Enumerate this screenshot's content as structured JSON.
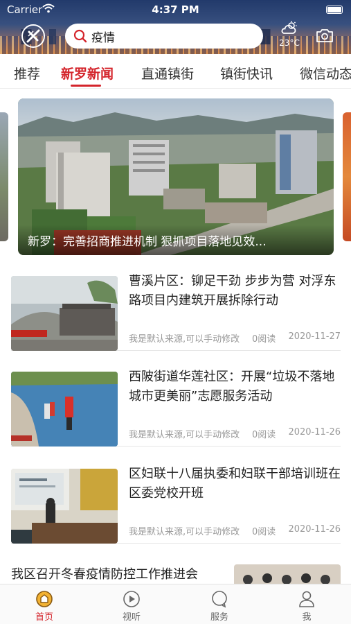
{
  "status_bar": {
    "carrier": "Carrier",
    "time": "4:37 PM"
  },
  "header": {
    "logo_icon": "app-logo-icon",
    "search": {
      "value": "疫情",
      "placeholder": "疫情"
    },
    "weather": {
      "icon": "cloud-sun-icon",
      "temperature": "23°C"
    },
    "camera_icon": "camera-icon"
  },
  "category_tabs": [
    {
      "label": "推荐",
      "active": false
    },
    {
      "label": "新罗新闻",
      "active": true
    },
    {
      "label": "直通镇街",
      "active": false
    },
    {
      "label": "镇街快讯",
      "active": false
    },
    {
      "label": "微信动态",
      "active": false
    }
  ],
  "banner": {
    "caption": "新罗：完善招商推进机制 狠抓项目落地见效..."
  },
  "news": [
    {
      "title": "曹溪片区：铆足干劲 步步为营 对浮东路项目内建筑开展拆除行动",
      "source": "我是默认来源,可以手动修改",
      "reads": "0阅读",
      "date": "2020-11-27"
    },
    {
      "title": "西陂街道华莲社区：开展“垃圾不落地 城市更美丽”志愿服务活动",
      "source": "我是默认来源,可以手动修改",
      "reads": "0阅读",
      "date": "2020-11-26"
    },
    {
      "title": "区妇联十八届执委和妇联干部培训班在区委党校开班",
      "source": "我是默认来源,可以手动修改",
      "reads": "0阅读",
      "date": "2020-11-26"
    }
  ],
  "news_partial": {
    "title": "我区召开冬春疫情防控工作推进会"
  },
  "tabbar": [
    {
      "label": "首页",
      "icon": "home-icon",
      "active": true
    },
    {
      "label": "视听",
      "icon": "play-icon",
      "active": false
    },
    {
      "label": "服务",
      "icon": "service-icon",
      "active": false
    },
    {
      "label": "我",
      "icon": "user-icon",
      "active": false
    }
  ],
  "colors": {
    "accent": "#d4242b",
    "meta_text": "#999999"
  }
}
